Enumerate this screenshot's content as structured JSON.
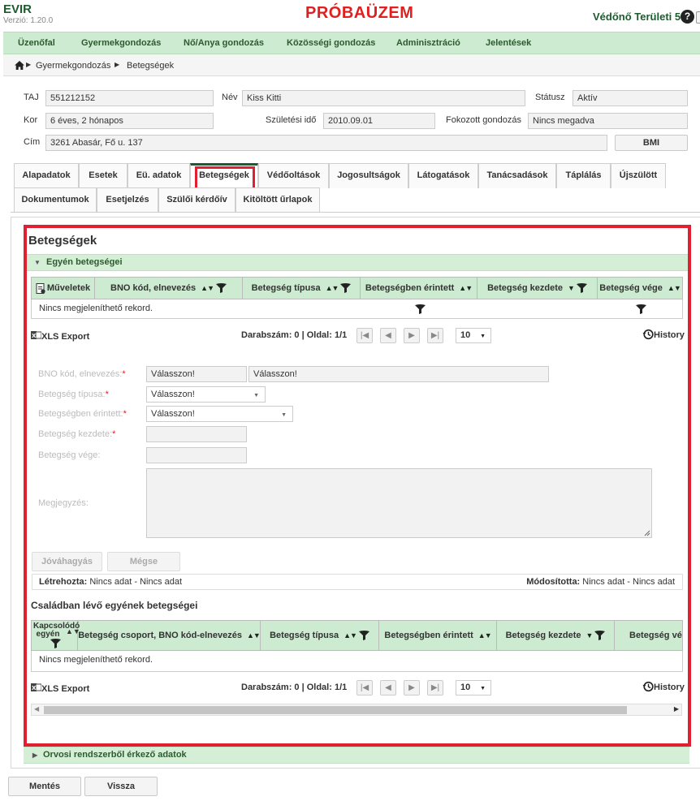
{
  "app": {
    "title": "EVIR",
    "version": "Verzió: 1.20.0",
    "trial_banner": "PRÓBAÜZEM",
    "district": "Védőnő Területi 5",
    "help": "?"
  },
  "menu": [
    "Üzenőfal",
    "Gyermekgondozás",
    "Nő/Anya gondozás",
    "Közösségi gondozás",
    "Adminisztráció",
    "Jelentések"
  ],
  "breadcrumb": [
    "Gyermekgondozás",
    "Betegségek"
  ],
  "patient": {
    "taj_label": "TAJ",
    "taj": "551212152",
    "name_label": "Név",
    "name": "Kiss Kitti",
    "status_label": "Státusz",
    "status": "Aktív",
    "age_label": "Kor",
    "age": "6 éves, 2 hónapos",
    "birth_label": "Születési idő",
    "birth": "2010.09.01",
    "care_label": "Fokozott gondozás",
    "care": "Nincs megadva",
    "address_label": "Cím",
    "address": "3261 Abasár, Fő u. 137",
    "bmi_button": "BMI"
  },
  "tabs_row1": [
    "Alapadatok",
    "Esetek",
    "Eü. adatok",
    "Betegségek",
    "Védőoltások",
    "Jogosultságok",
    "Látogatások",
    "Tanácsadások",
    "Táplálás",
    "Újszülött"
  ],
  "tabs_row2": [
    "Dokumentumok",
    "Esetjelzés",
    "Szülői kérdőív",
    "Kitöltött űrlapok"
  ],
  "section": {
    "title": "Betegségek",
    "own_accordion": "Egyén betegségei",
    "own_columns": [
      "Műveletek",
      "BNO kód, elnevezés",
      "Betegség típusa",
      "Betegségben érintett",
      "Betegség kezdete",
      "Betegség vége"
    ],
    "empty": "Nincs megjeleníthető rekord.",
    "xls": "XLS Export",
    "count": "Darabszám: 0 | Oldal: 1/1",
    "page_size": "10",
    "history": "History",
    "form": {
      "bno_label": "BNO kód, elnevezés:",
      "bno_code": "Válasszon!",
      "bno_name": "Válasszon!",
      "type_label": "Betegség típusa:",
      "type_value": "Válasszon!",
      "affected_label": "Betegségben érintett:",
      "affected_value": "Válasszon!",
      "start_label": "Betegség kezdete:",
      "end_label": "Betegség vége:",
      "note_label": "Megjegyzés:",
      "approve": "Jóváhagyás",
      "cancel": "Mégse",
      "required_mark": "*"
    },
    "audit": {
      "created_label": "Létrehozta:",
      "created_value": "Nincs adat - Nincs adat",
      "modified_label": "Módosította:",
      "modified_value": "Nincs adat - Nincs adat"
    },
    "family_title": "Családban lévő egyének betegségei",
    "family_columns": [
      "Kapcsolódó egyén",
      "Betegség csoport, BNO kód-elnevezés",
      "Betegség típusa",
      "Betegségben érintett",
      "Betegség kezdete",
      "Betegség vég"
    ],
    "family_empty": "Nincs megjeleníthető rekord.",
    "external_accordion": "Orvosi rendszerből érkező adatok"
  },
  "footer": {
    "save": "Mentés",
    "back": "Vissza"
  },
  "colors": {
    "brand": "#1c5b2e",
    "menu_bg": "#ccebd0",
    "alert": "#e02020"
  }
}
